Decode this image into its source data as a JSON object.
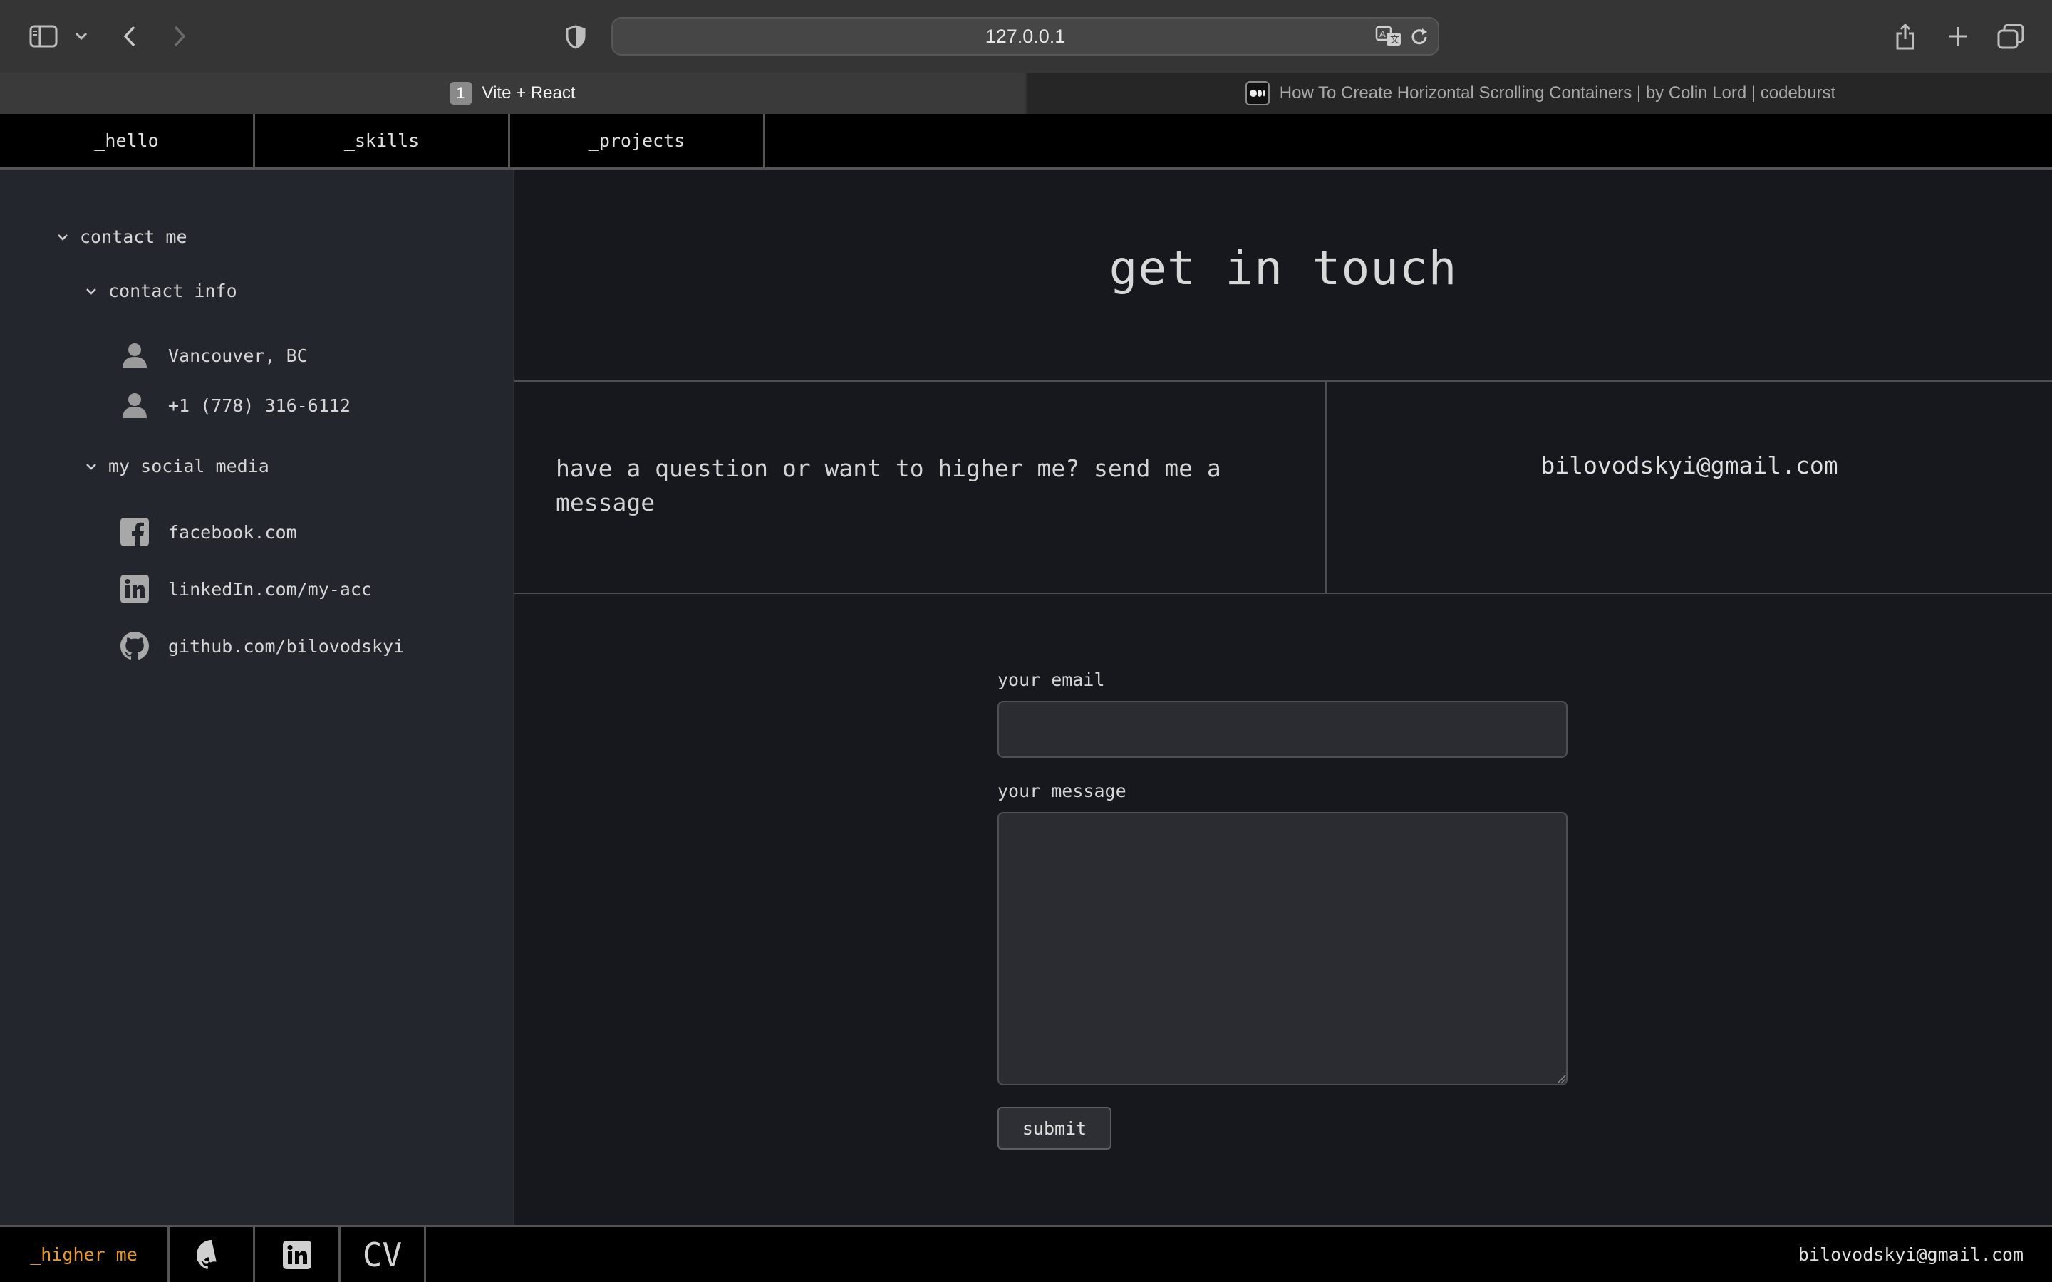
{
  "browser": {
    "address": "127.0.0.1",
    "tabs": [
      {
        "badge": "1",
        "title": "Vite + React",
        "active": true
      },
      {
        "favicon": "medium-icon",
        "title": "How To Create Horizontal Scrolling Containers | by Colin Lord | codeburst",
        "active": false
      }
    ]
  },
  "nav": {
    "items": [
      "_hello",
      "_skills",
      "_projects"
    ]
  },
  "sidebar": {
    "root_label": "contact me",
    "contact_info": {
      "label": "contact info",
      "items": [
        {
          "icon": "person-icon",
          "text": "Vancouver, BC"
        },
        {
          "icon": "person-icon",
          "text": "+1 (778) 316-6112"
        }
      ]
    },
    "social": {
      "label": "my social media",
      "items": [
        {
          "icon": "facebook-icon",
          "text": "facebook.com"
        },
        {
          "icon": "linkedin-icon",
          "text": "linkedIn.com/my-acc"
        },
        {
          "icon": "github-icon",
          "text": "github.com/bilovodskyi"
        }
      ]
    }
  },
  "main": {
    "title": "get in touch",
    "question": "have a question or want to higher me? send me a message",
    "email": "bilovodskyi@gmail.com",
    "form": {
      "email_label": "your email",
      "email_value": "",
      "message_label": "your message",
      "message_value": "",
      "submit_label": "submit"
    }
  },
  "footer": {
    "hire_label": "_higher me",
    "cv_label": "CV",
    "email": "bilovodskyi@gmail.com"
  },
  "colors": {
    "accent": "#e79a2c",
    "background": "#16181d",
    "sidebar": "#23262c"
  }
}
